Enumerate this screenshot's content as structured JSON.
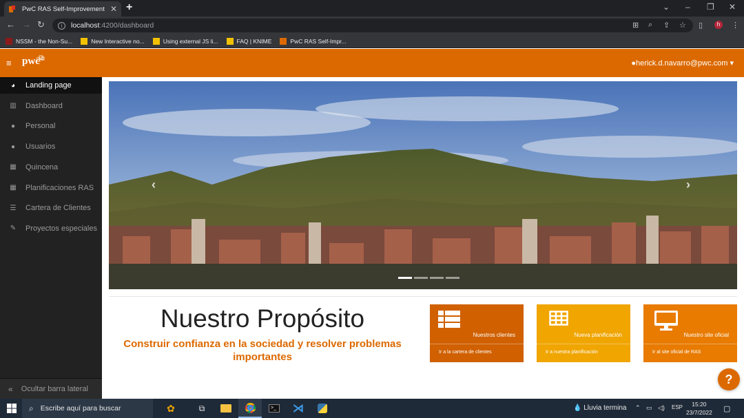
{
  "browser": {
    "tab_title": "PwC RAS Self-Improvement",
    "tab_close": "✕",
    "new_tab": "+",
    "url_host": "localhost",
    "url_rest": ":4200/dashboard",
    "bookmarks": [
      {
        "label": "NSSM - the Non-Su...",
        "color": "#8b1a1a"
      },
      {
        "label": "New Interactive no...",
        "color": "#f2c200"
      },
      {
        "label": "Using external JS li...",
        "color": "#f2c200"
      },
      {
        "label": "FAQ | KNIME",
        "color": "#f2c200"
      },
      {
        "label": "PwC RAS Self-Impr...",
        "color": "#dc6900"
      }
    ]
  },
  "header": {
    "logo_text": "pwc",
    "user": "herick.d.navarro@pwc.com"
  },
  "sidebar": {
    "items": [
      {
        "label": "Landing page",
        "icon": "dashboard-icon",
        "glyph": "◕",
        "active": true
      },
      {
        "label": "Dashboard",
        "icon": "bar-chart-icon",
        "glyph": "▥",
        "active": false
      },
      {
        "label": "Personal",
        "icon": "user-icon",
        "glyph": "●",
        "active": false
      },
      {
        "label": "Usuarios",
        "icon": "user-icon",
        "glyph": "●",
        "active": false
      },
      {
        "label": "Quincena",
        "icon": "table-icon",
        "glyph": "▦",
        "active": false
      },
      {
        "label": "Planificaciones RAS",
        "icon": "table-icon",
        "glyph": "▦",
        "active": false
      },
      {
        "label": "Cartera de Clientes",
        "icon": "list-icon",
        "glyph": "☰",
        "active": false
      },
      {
        "label": "Proyectos especiales",
        "icon": "wrench-icon",
        "glyph": "✎",
        "active": false
      }
    ],
    "footer_label": "Ocultar barra lateral"
  },
  "carousel": {
    "prev": "‹",
    "next": "›",
    "slide_count": 4,
    "active_slide": 1
  },
  "purpose": {
    "title": "Nuestro Propósito",
    "text": "Construir confianza en la sociedad y resolver problemas importantes"
  },
  "cards": [
    {
      "title": "Nuestros clientes",
      "footer": "Ir a la cartera de clientes",
      "icon": "list-icon"
    },
    {
      "title": "Nueva planificación",
      "footer": "Ir a nuestra planificación",
      "icon": "table-icon"
    },
    {
      "title": "Nuestro site oficial",
      "footer": "Ir al site oficial de RAS",
      "icon": "monitor-icon"
    }
  ],
  "help": "?",
  "taskbar": {
    "search_placeholder": "Escribe aquí para buscar",
    "weather": "Lluvia termina",
    "lang": "ESP",
    "time": "15:20",
    "date": "23/7/2022"
  }
}
